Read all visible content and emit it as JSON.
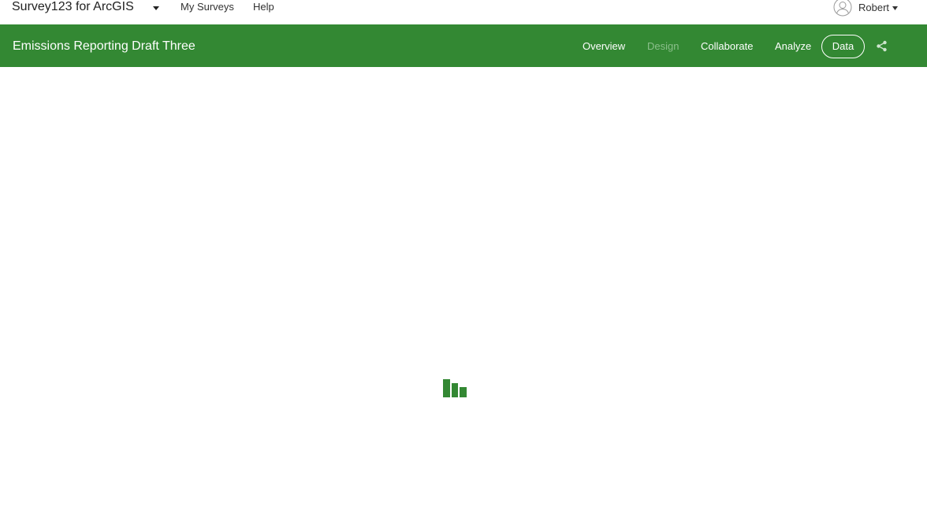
{
  "header": {
    "app_title": "Survey123 for ArcGIS",
    "links": {
      "my_surveys": "My Surveys",
      "help": "Help"
    },
    "user": {
      "name": "Robert"
    }
  },
  "survey": {
    "title": "Emissions Reporting Draft Three",
    "nav": {
      "overview": "Overview",
      "design": "Design",
      "collaborate": "Collaborate",
      "analyze": "Analyze",
      "data": "Data"
    }
  },
  "colors": {
    "brand_green": "#338833",
    "design_disabled": "#8bbf8b"
  }
}
